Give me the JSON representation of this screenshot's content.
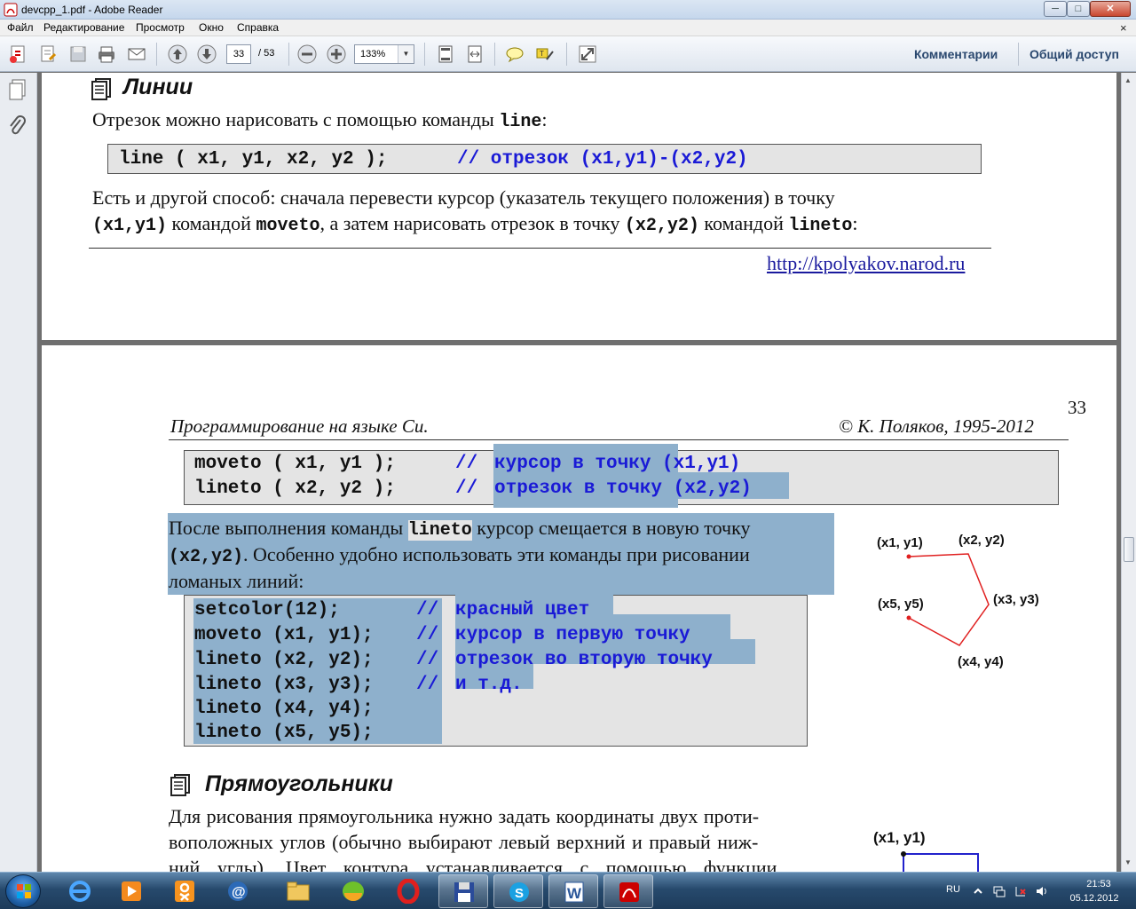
{
  "window": {
    "title": "devcpp_1.pdf - Adobe Reader",
    "minimize": "─",
    "maximize": "□",
    "close": "✕"
  },
  "menu": {
    "items": [
      "Файл",
      "Редактирование",
      "Просмотр",
      "Окно",
      "Справка"
    ],
    "close_glyph": "×"
  },
  "toolbar": {
    "current_page": "33",
    "page_total": "/ 53",
    "zoom": "133%",
    "comments_label": "Комментарии",
    "share_label": "Общий доступ"
  },
  "page1": {
    "heading": "Линии",
    "intro_text": "Отрезок можно нарисовать с помощью команды ",
    "intro_code": "line",
    "intro_end": ":",
    "code_line": "line ( x1, y1, x2, y2 );",
    "code_comment": "// отрезок (x1,y1)-(x2,y2)",
    "para_line1": "Есть и другой способ: сначала перевести курсор (указатель текущего положения) в точку",
    "para2_code1": "(x1,y1)",
    "para2_text1": " командой ",
    "para2_code2": "moveto",
    "para2_text2": ", а затем нарисовать отрезок в точку ",
    "para2_code3": "(x2,y2)",
    "para2_text3": " командой ",
    "para2_code4": "lineto",
    "para2_text4": ":",
    "url": "http://kpolyakov.narod.ru"
  },
  "page2": {
    "page_number": "33",
    "header_left": "Программирование на языке Си.",
    "header_right": "© К. Поляков, 1995-2012",
    "box1": [
      {
        "code": "moveto ( x1, y1 );",
        "comment_slash": "//",
        "comment": "курсор в точку (x1,y1)"
      },
      {
        "code": "lineto ( x2, y2 );",
        "comment_slash": "//",
        "comment": "отрезок в точку (x2,y2)"
      }
    ],
    "para1_a": "После выполнения команды ",
    "para1_code": "lineto",
    "para1_b": " курсор смещается в новую точку",
    "para1_code2": "(x2,y2)",
    "para1_c": ". Особенно удобно использовать эти команды при рисовании",
    "para1_d": "ломаных линий:",
    "box2": [
      {
        "code": "setcolor(12);",
        "comment_slash": "//",
        "comment": "красный цвет"
      },
      {
        "code": "moveto (x1, y1);",
        "comment_slash": "//",
        "comment": "курсор в первую точку"
      },
      {
        "code": "lineto (x2, y2);",
        "comment_slash": "//",
        "comment": "отрезок во вторую точку"
      },
      {
        "code": "lineto (x3, y3);",
        "comment_slash": "//",
        "comment": "и т.д."
      },
      {
        "code": "lineto (x4, y4);",
        "comment_slash": "",
        "comment": ""
      },
      {
        "code": "lineto (x5, y5);",
        "comment_slash": "",
        "comment": ""
      }
    ],
    "diagram_labels": {
      "p1": "(x1, y1)",
      "p2": "(x2, y2)",
      "p3": "(x3, y3)",
      "p4": "(x4, y4)",
      "p5": "(x5, y5)",
      "rect_p1": "(x1, y1)"
    },
    "heading2": "Прямоугольники",
    "para2_line1": "Для рисования прямоугольника нужно задать координаты двух проти-",
    "para2_line2": "воположных углов (обычно выбирают левый верхний и правый ниж-",
    "para2_line3": "ний углы). Цвет контура устанавливается с помощью функции"
  },
  "taskbar": {
    "lang": "RU",
    "time": "21:53",
    "date": "05.12.2012"
  },
  "colors": {
    "selection": "#8eb0cc",
    "code_comment": "#1a1ad6",
    "polyline": "#e02020",
    "rect_outline": "#2222cc"
  }
}
